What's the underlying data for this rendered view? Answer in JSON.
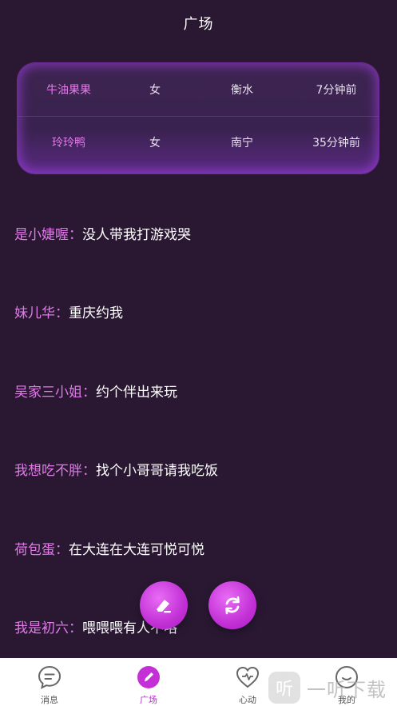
{
  "header": {
    "title": "广场"
  },
  "online_users": [
    {
      "name": "牛油果果",
      "gender": "女",
      "city": "衡水",
      "time": "7分钟前"
    },
    {
      "name": "玲玲鸭",
      "gender": "女",
      "city": "南宁",
      "time": "35分钟前"
    }
  ],
  "posts": [
    {
      "nick": "是小婕喔",
      "sep": "：",
      "text": "没人带我打游戏哭"
    },
    {
      "nick": "妹儿华",
      "sep": "：",
      "text": "重庆约我"
    },
    {
      "nick": "吴家三小姐",
      "sep": "：",
      "text": "约个伴出来玩"
    },
    {
      "nick": "我想吃不胖",
      "sep": "：",
      "text": "找个小哥哥请我吃饭"
    },
    {
      "nick": "荷包蛋",
      "sep": "：",
      "text": "在大连在大连可悦可悦"
    },
    {
      "nick": "我是初六",
      "sep": "：",
      "text": "喂喂喂有人不咯"
    }
  ],
  "tabbar": {
    "tabs": [
      {
        "label": "消息",
        "icon": "message-icon"
      },
      {
        "label": "广场",
        "icon": "square-pen-icon",
        "active": true
      },
      {
        "label": "心动",
        "icon": "heart-icon"
      },
      {
        "label": "我的",
        "icon": "profile-icon"
      }
    ]
  },
  "watermark": {
    "logo_char": "听",
    "text": "一听下载"
  },
  "colors": {
    "background": "#2a1833",
    "accent": "#c231d6",
    "nickname": "#e07be8"
  }
}
